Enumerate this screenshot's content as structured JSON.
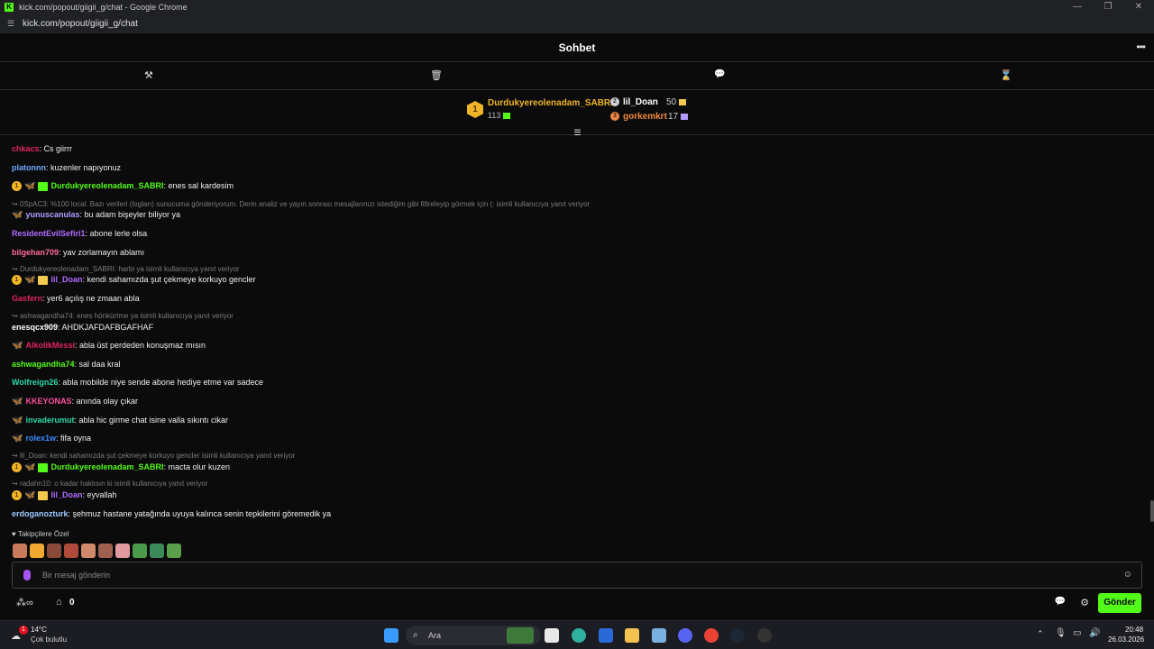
{
  "browser": {
    "title": "kick.com/popout/giigii_g/chat - Google Chrome",
    "url": "kick.com/popout/giigii_g/chat"
  },
  "header": {
    "title": "Sohbet"
  },
  "leaderboard": {
    "first": {
      "rank": "1",
      "name": "Durdukyereolenadam_SABRI",
      "count": "113"
    },
    "second": {
      "name": "lil_Doan",
      "count": "50"
    },
    "third": {
      "name": "gorkemkrt",
      "count": "17"
    }
  },
  "messages": [
    {
      "user": "chkacs",
      "color": "#e0245e",
      "text": ": Cs giirrr"
    },
    {
      "user": "platonnn",
      "color": "#6fa8ff",
      "text": ": kuzenler napıyonuz"
    },
    {
      "user": "Durdukyereolenadam_SABRI",
      "color": "#53fc18",
      "text": ": enes sal kardesim"
    },
    {
      "reply": "0SpAC3: %100 local. Bazı verileri (logları) sunucuma gönderiyorum. Derin analiz ve yayın sonrası mesajlarınızı istediğim gibi filtreleyip görmek için (: isimli kullanıcıya yanıt veriyor"
    },
    {
      "user": "yunuscanulas",
      "color": "#b49cff",
      "text": ": bu adam bişeyler biliyor ya"
    },
    {
      "user": "ResidentEvilSefiri1",
      "color": "#b06bff",
      "text": ": abone lerle olsa"
    },
    {
      "user": "bilgehan709",
      "color": "#ff6b9a",
      "text": ": yav zorlamayın ablamı"
    },
    {
      "reply": "Durdukyereolenadam_SABRI: harbi ya isimli kullanıcıya yanıt veriyor"
    },
    {
      "user": "lil_Doan",
      "color": "#b06bff",
      "text": ": kendi sahamızda şut çekmeye korkuyo gencler"
    },
    {
      "user": "Gasfern",
      "color": "#e0245e",
      "text": ": yer6 açılış ne zmaan abla"
    },
    {
      "reply": "ashwagandha74: enes hönkürtme ya isimli kullanıcıya yanıt veriyor"
    },
    {
      "user": "enesqcx909",
      "color": "#ffffff",
      "text": ": AHDKJAFDAFBGAFHAF"
    },
    {
      "user": "AlkolikMessi",
      "color": "#e0245e",
      "text": ": abla üst perdeden konuşmaz mısın"
    },
    {
      "user": "ashwagandha74",
      "color": "#53fc18",
      "text": ": sal daa kral"
    },
    {
      "user": "Wolfreign26",
      "color": "#2bd9a8",
      "text": ": abla mobilde niye sende abone hediye etme var sadece"
    },
    {
      "user": "KKEYONAS",
      "color": "#ff4fa1",
      "text": ": anında olay çıkar"
    },
    {
      "user": "invaderumut",
      "color": "#2bd9a8",
      "text": ": abla hic girme chat isine valla sıkıntı cikar"
    },
    {
      "user": "rolex1w",
      "color": "#3a8bff",
      "text": ": fifa oyna"
    },
    {
      "reply": "lil_Doan: kendi sahamızda şut çekmeye korkuyo gencler isimli kullanıcıya yanıt veriyor"
    },
    {
      "user": "Durdukyereolenadam_SABRI",
      "color": "#53fc18",
      "text": ": macta olur kuzen"
    },
    {
      "reply": "radahn10: o kadar haklısın ki isimli kullanıcıya yanıt veriyor"
    },
    {
      "user": "lil_Doan",
      "color": "#b06bff",
      "text": ": eyvallah"
    },
    {
      "user": "erdoganozturk",
      "color": "#9ec9ff",
      "text": ": şehmuz hastane yatağında uyuya kalınca senin tepkilerini göremedik ya"
    }
  ],
  "emotes": {
    "label": "Takipçilere Özel"
  },
  "input": {
    "placeholder": "Bir mesaj gönderin"
  },
  "bottom": {
    "points": "0",
    "send": "Gönder"
  },
  "taskbar": {
    "weather_temp": "14°C",
    "weather_desc": "Çok bulutlu",
    "search": "Ara",
    "time": "20:48",
    "date": "26.03.2026",
    "weather_badge": "1"
  }
}
